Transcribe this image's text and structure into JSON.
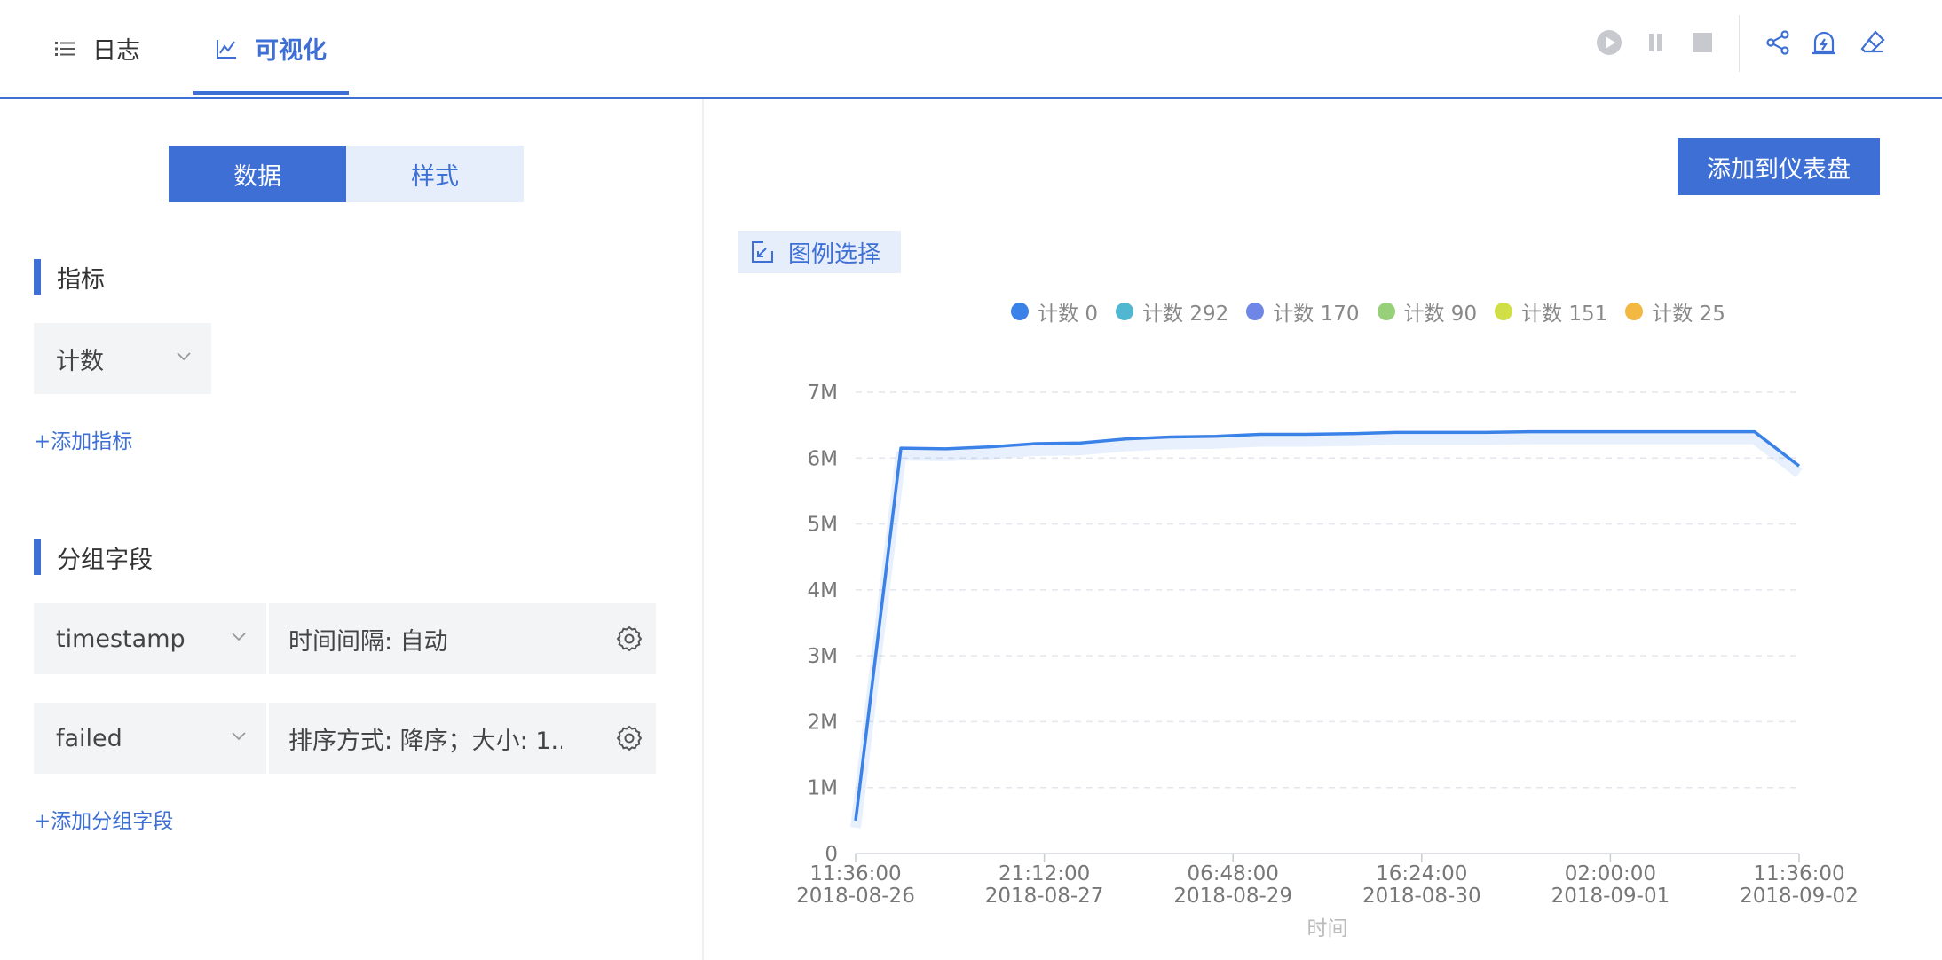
{
  "tabs": {
    "log": {
      "label": "日志",
      "icon": "list-icon"
    },
    "visualize": {
      "label": "可视化",
      "icon": "line-chart-icon"
    }
  },
  "toolbar": [
    "play-icon",
    "pause-icon",
    "stop-icon",
    "share-icon",
    "alert-bell-icon",
    "eraser-icon"
  ],
  "left": {
    "segmented": {
      "data_label": "数据",
      "style_label": "样式"
    },
    "metrics": {
      "title": "指标",
      "metric_value": "计数",
      "add_label": "+添加指标"
    },
    "group": {
      "title": "分组字段",
      "fields": [
        {
          "field": "timestamp",
          "param": "时间间隔: 自动"
        },
        {
          "field": "failed",
          "param": "排序方式: 降序；大小: 1..."
        }
      ],
      "add_label": "+添加分组字段"
    }
  },
  "right": {
    "add_dashboard_label": "添加到仪表盘",
    "legend_select_label": "图例选择"
  },
  "colors": {
    "accent": "#3d6fd4",
    "series_line": "#3b82e8"
  },
  "chart_data": {
    "type": "line",
    "xlabel": "时间",
    "ylabel": "",
    "ylim": [
      0,
      7000000
    ],
    "y_ticks": [
      "0",
      "1M",
      "2M",
      "3M",
      "4M",
      "5M",
      "6M",
      "7M"
    ],
    "x_ticks": [
      {
        "time": "11:36:00",
        "date": "2018-08-26"
      },
      {
        "time": "21:12:00",
        "date": "2018-08-27"
      },
      {
        "time": "06:48:00",
        "date": "2018-08-29"
      },
      {
        "time": "16:24:00",
        "date": "2018-08-30"
      },
      {
        "time": "02:00:00",
        "date": "2018-09-01"
      },
      {
        "time": "11:36:00",
        "date": "2018-09-02"
      }
    ],
    "grid": true,
    "legend_position": "top",
    "series": [
      {
        "name": "计数 0",
        "color": "#3b82e8",
        "x": [
          "2018-08-26 11:36",
          "2018-08-26 19:40",
          "2018-08-27 03:40",
          "2018-08-27 11:40",
          "2018-08-27 19:40",
          "2018-08-28 03:40",
          "2018-08-28 11:40",
          "2018-08-28 19:40",
          "2018-08-29 03:40",
          "2018-08-29 11:40",
          "2018-08-29 19:40",
          "2018-08-30 03:40",
          "2018-08-30 11:40",
          "2018-08-30 19:40",
          "2018-08-31 03:40",
          "2018-08-31 11:40",
          "2018-08-31 19:40",
          "2018-09-01 03:40",
          "2018-09-01 11:40",
          "2018-09-01 19:40",
          "2018-09-02 03:40",
          "2018-09-02 11:36"
        ],
        "values": [
          500000,
          6150000,
          6140000,
          6170000,
          6220000,
          6230000,
          6290000,
          6320000,
          6330000,
          6360000,
          6360000,
          6370000,
          6390000,
          6390000,
          6390000,
          6400000,
          6400000,
          6400000,
          6400000,
          6400000,
          6400000,
          5880000
        ]
      },
      {
        "name": "计数 292",
        "color": "#4fb8d0"
      },
      {
        "name": "计数 170",
        "color": "#6e86e6"
      },
      {
        "name": "计数 90",
        "color": "#98d07a"
      },
      {
        "name": "计数 151",
        "color": "#cfdf45"
      },
      {
        "name": "计数 25",
        "color": "#f2b842"
      }
    ]
  }
}
